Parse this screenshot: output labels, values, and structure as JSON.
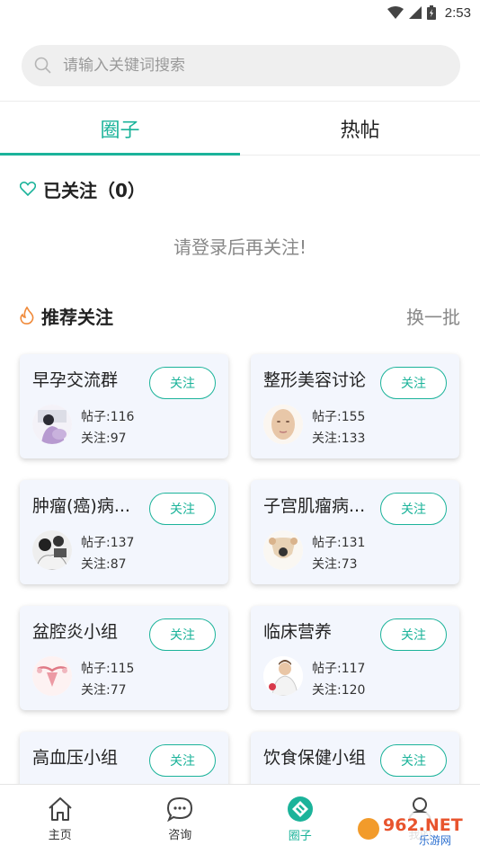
{
  "status_bar": {
    "time": "2:53"
  },
  "search": {
    "placeholder": "请输入关键词搜索"
  },
  "tabs": [
    {
      "label": "圈子",
      "active": true
    },
    {
      "label": "热帖",
      "active": false
    }
  ],
  "followed": {
    "title": "已关注（0）",
    "empty_tip": "请登录后再关注!"
  },
  "recommend": {
    "title": "推荐关注",
    "refresh_label": "换一批",
    "groups": [
      {
        "name": "早孕交流群",
        "posts": "帖子:116",
        "followers": "关注:97",
        "button": "关注",
        "avatar": "pregnant-woman-avatar"
      },
      {
        "name": "整形美容讨论",
        "posts": "帖子:155",
        "followers": "关注:133",
        "button": "关注",
        "avatar": "face-avatar"
      },
      {
        "name": "肿瘤(癌)病...",
        "posts": "帖子:137",
        "followers": "关注:87",
        "button": "关注",
        "avatar": "patient-avatar"
      },
      {
        "name": "子宫肌瘤病...",
        "posts": "帖子:131",
        "followers": "关注:73",
        "button": "关注",
        "avatar": "uterus-avatar"
      },
      {
        "name": "盆腔炎小组",
        "posts": "帖子:115",
        "followers": "关注:77",
        "button": "关注",
        "avatar": "pelvis-avatar"
      },
      {
        "name": "临床营养",
        "posts": "帖子:117",
        "followers": "关注:120",
        "button": "关注",
        "avatar": "nurse-avatar"
      },
      {
        "name": "高血压小组",
        "posts": "",
        "followers": "",
        "button": "关注",
        "avatar": ""
      },
      {
        "name": "饮食保健小组",
        "posts": "",
        "followers": "",
        "button": "关注",
        "avatar": ""
      }
    ]
  },
  "bottom_nav": [
    {
      "label": "主页",
      "icon": "home-icon",
      "active": false
    },
    {
      "label": "咨询",
      "icon": "chat-icon",
      "active": false
    },
    {
      "label": "圈子",
      "icon": "circle-icon",
      "active": true
    },
    {
      "label": "我的",
      "icon": "user-icon",
      "active": false
    }
  ],
  "watermark": {
    "text": "962.NET",
    "subtext": "乐游网"
  },
  "colors": {
    "accent": "#1bb39a",
    "flame": "#f08a3a",
    "card_bg": "#f3f6fd"
  }
}
